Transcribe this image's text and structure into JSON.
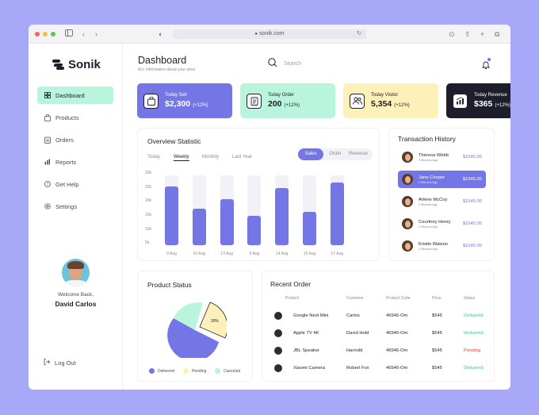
{
  "browser": {
    "url": "sonik.com",
    "lock_glyph": "🔒",
    "dots": [
      "#ec6a5f",
      "#f4bf4f",
      "#61c554"
    ]
  },
  "sidebar": {
    "brand": "Sonik",
    "items": [
      {
        "label": "Dashboard",
        "icon": "grid-icon",
        "glyph": "▦"
      },
      {
        "label": "Products",
        "icon": "bag-icon",
        "glyph": "🛍"
      },
      {
        "label": "Orders",
        "icon": "clipboard-icon",
        "glyph": "📋"
      },
      {
        "label": "Reports",
        "icon": "chart-icon",
        "glyph": "📊"
      },
      {
        "label": "Get Help",
        "icon": "help-icon",
        "glyph": "?"
      },
      {
        "label": "Settings",
        "icon": "gear-icon",
        "glyph": "⚙"
      }
    ],
    "welcome": "Welcome Back,",
    "user_name": "David Carlos",
    "logout": "Log Out"
  },
  "header": {
    "title": "Dashboard",
    "subtitle": "ALL information about your store",
    "search_placeholder": "Search"
  },
  "stats": [
    {
      "label": "Today Sell",
      "value": "$2,300",
      "change": "(+12%)",
      "bg": "#7476e6",
      "fg": "#ffffff",
      "icon": "bag-icon",
      "glyph": "🛍"
    },
    {
      "label": "Today Order",
      "value": "200",
      "change": "(+12%)",
      "bg": "#b9f5dd",
      "fg": "#1d1d2c",
      "icon": "clipboard-icon",
      "glyph": "📋"
    },
    {
      "label": "Today Visitor",
      "value": "5,354",
      "change": "(+12%)",
      "bg": "#fdf0b8",
      "fg": "#1d1d2c",
      "icon": "users-icon",
      "glyph": "👥"
    },
    {
      "label": "Today Revenue",
      "value": "$365",
      "change": "(+12%)",
      "bg": "#1d1d2c",
      "fg": "#ffffff",
      "icon": "chart-up-icon",
      "glyph": "📈"
    }
  ],
  "overview": {
    "title": "Overview Statistic",
    "periods": [
      "Today",
      "Weekly",
      "Monthly",
      "Last Year"
    ],
    "active_period": "Weekly",
    "metrics": [
      "Sales",
      "Order",
      "Revenue"
    ],
    "active_metric": "Sales"
  },
  "chart_data": {
    "type": "bar",
    "categories": [
      "9 Aug",
      "10 Aug",
      "13 Aug",
      "9 Aug",
      "14 Aug",
      "15 Aug",
      "17 Aug"
    ],
    "values": [
      21000,
      13000,
      16500,
      10500,
      20500,
      12000,
      22500
    ],
    "yticks": [
      "30k",
      "25k",
      "20k",
      "15k",
      "10k",
      "5k"
    ],
    "ylim": [
      0,
      25000
    ],
    "color": "#7476e6",
    "track_color": "#f1f1f7"
  },
  "transactions": {
    "title": "Transaction History",
    "items": [
      {
        "name": "Theresa Webb",
        "date": "2 Minutes Ago",
        "amount": "$1545.00"
      },
      {
        "name": "Jane Cooper",
        "date": "2 Minutes Ago",
        "amount": "$1545.00"
      },
      {
        "name": "Arlene McCoy",
        "date": "2 Minutes Ago",
        "amount": "$1545.00"
      },
      {
        "name": "Courtney Henry",
        "date": "2 Minutes Ago",
        "amount": "$1545.00"
      },
      {
        "name": "Kristin Watson",
        "date": "2 Minutes Ago",
        "amount": "$1545.00"
      }
    ],
    "active_index": 1
  },
  "product_status": {
    "title": "Product Status",
    "pie_label": "30%",
    "slices": [
      {
        "name": "Delivered",
        "value": 55,
        "color": "#7476e6"
      },
      {
        "name": "Pending",
        "value": 30,
        "color": "#fdf0b8"
      },
      {
        "name": "Canceled",
        "value": 15,
        "color": "#b9f5dd"
      }
    ],
    "legend": [
      "Delivered",
      "Pending",
      "Canceled"
    ]
  },
  "recent_order": {
    "title": "Recent Order",
    "columns": [
      "Product",
      "Customer",
      "Product Code",
      "Price",
      "Status"
    ],
    "rows": [
      {
        "product": "Google Nest Mini",
        "customer": "Carlos",
        "code": "46546-Om",
        "price": "$545",
        "status": "Delivered",
        "status_color": "#3bc48a"
      },
      {
        "product": "Apple TV 4K",
        "customer": "David Hold",
        "code": "46546-Om",
        "price": "$545",
        "status": "Delivered",
        "status_color": "#3bc48a"
      },
      {
        "product": "JBL Speaker",
        "customer": "Harnold",
        "code": "46546-Om",
        "price": "$545",
        "status": "Pending",
        "status_color": "#e2453f"
      },
      {
        "product": "Xiaomi Camera",
        "customer": "Robert Fox",
        "code": "46546-Om",
        "price": "$545",
        "status": "Delivered",
        "status_color": "#3bc48a"
      }
    ]
  }
}
